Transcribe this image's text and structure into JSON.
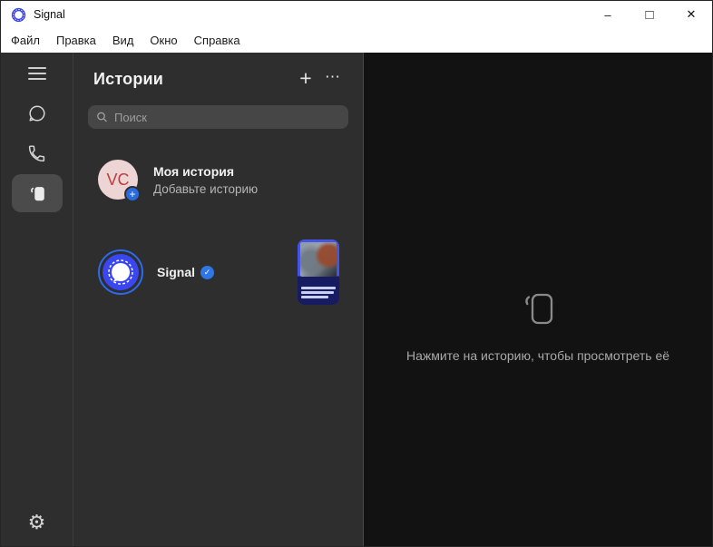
{
  "window": {
    "title": "Signal",
    "controls": {
      "minimize": "–",
      "maximize": "□",
      "close": "✕"
    }
  },
  "menu": {
    "items": [
      "Файл",
      "Правка",
      "Вид",
      "Окно",
      "Справка"
    ]
  },
  "nav": {
    "items": [
      {
        "icon": "menu-icon"
      },
      {
        "icon": "chats-icon"
      },
      {
        "icon": "calls-icon"
      },
      {
        "icon": "stories-icon",
        "active": true
      }
    ],
    "settings_icon": "gear-icon"
  },
  "stories_panel": {
    "title": "Истории",
    "actions": {
      "add": "+",
      "more": "⋯"
    },
    "search_placeholder": "Поиск",
    "my_story": {
      "initials": "VC",
      "title": "Моя история",
      "subtitle": "Добавьте историю"
    },
    "story_rows": [
      {
        "name": "Signal",
        "verified": true
      }
    ]
  },
  "empty_state": {
    "icon": "stories-icon",
    "message": "Нажмите на историю, чтобы просмотреть её"
  },
  "icons": {
    "gear": "⚙",
    "check": "✓"
  },
  "colors": {
    "titlebar_bg": "#ffffff",
    "panel_bg": "#2e2e2e",
    "main_bg": "#121212",
    "signal_blue": "#3a46f0",
    "story_ring": "#2c6bed",
    "verified_badge": "#2f76e8",
    "add_badge": "#2a6be0",
    "avatar_bg": "#eed5d5",
    "avatar_text": "#c13d3d"
  }
}
